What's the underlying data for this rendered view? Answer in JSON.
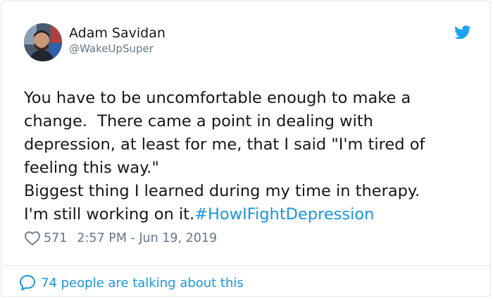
{
  "author": {
    "name": "Adam Savidan",
    "handle": "@WakeUpSuper"
  },
  "tweet": {
    "text": "You have to be uncomfortable enough to make a\nchange.  There came a point in dealing with\ndepression, at least for me, that I said \"I'm tired of\nfeeling this way.\"\nBiggest thing I learned during my time in therapy.\nI'm still working on it.",
    "hashtag": "#HowIFightDepression",
    "likes": "571",
    "timestamp": "2:57 PM - Jun 19, 2019"
  },
  "footer": {
    "talking_label": "74 people are talking about this"
  },
  "icons": {
    "brand": "twitter-bird-icon",
    "like": "heart-icon",
    "reply": "speech-bubble-icon"
  },
  "colors": {
    "link": "#1b95e0",
    "muted": "#657786",
    "text": "#14171a"
  }
}
